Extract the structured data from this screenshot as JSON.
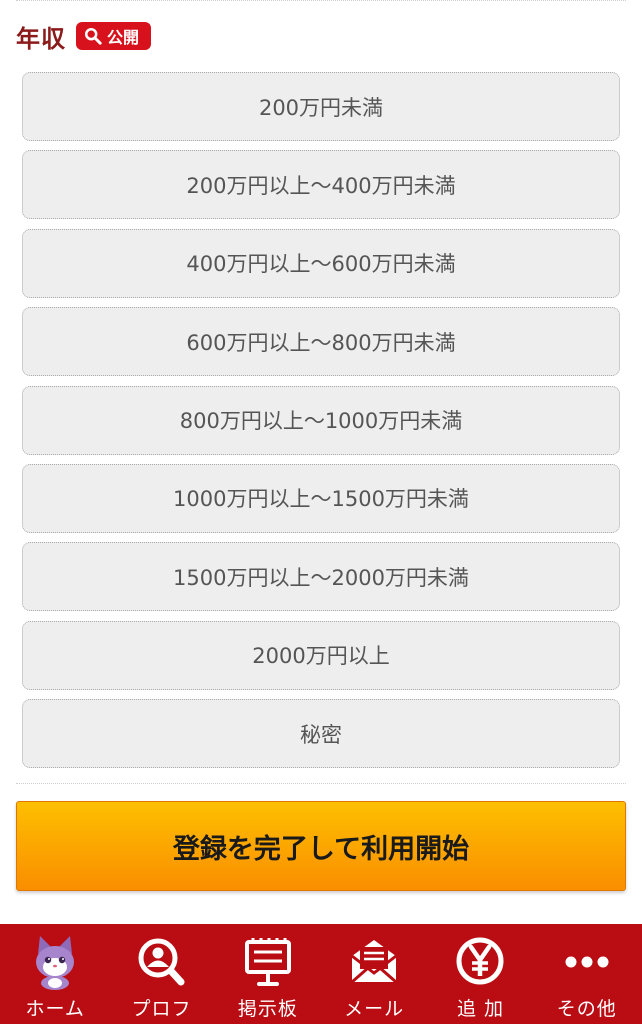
{
  "section": {
    "title": "年収",
    "badge": "公開"
  },
  "income_options": [
    "200万円未満",
    "200万円以上～400万円未満",
    "400万円以上～600万円未満",
    "600万円以上～800万円未満",
    "800万円以上～1000万円未満",
    "1000万円以上～1500万円未満",
    "1500万円以上～2000万円未満",
    "2000万円以上",
    "秘密"
  ],
  "submit": {
    "label": "登録を完了して利用開始"
  },
  "nav": [
    {
      "label": "ホーム",
      "icon": "cat-mascot-icon"
    },
    {
      "label": "プロフ",
      "icon": "profile-search-icon"
    },
    {
      "label": "掲示板",
      "icon": "bulletin-board-icon"
    },
    {
      "label": "メール",
      "icon": "mail-icon"
    },
    {
      "label": "追 加",
      "icon": "yen-coin-icon"
    },
    {
      "label": "その他",
      "icon": "more-dots-icon"
    }
  ],
  "colors": {
    "title": "#8b1a1a",
    "badge": "#d7121c",
    "nav_background": "#b90d13",
    "button_top": "#fdbf00",
    "button_bottom": "#fa8e00"
  }
}
